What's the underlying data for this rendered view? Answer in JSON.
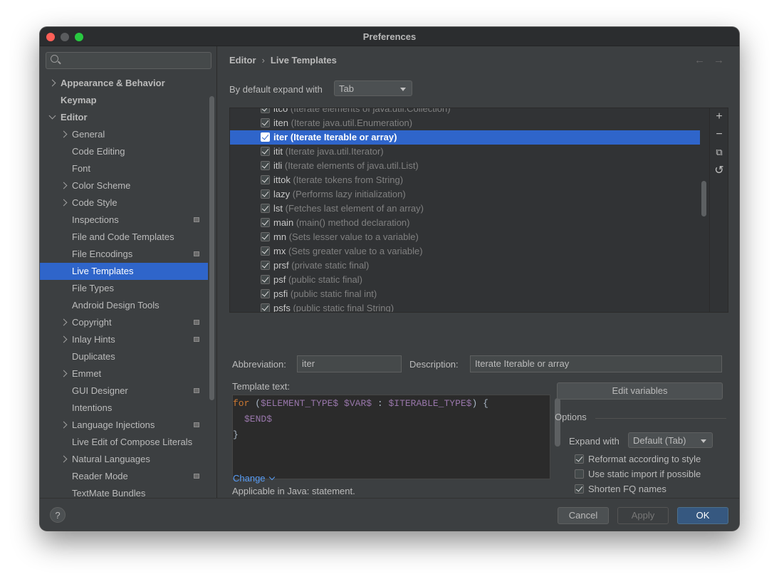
{
  "window": {
    "title": "Preferences"
  },
  "sidebar": {
    "search_placeholder": "",
    "items": [
      {
        "label": "Appearance & Behavior",
        "level": 0,
        "expander": "right",
        "bold": true,
        "selected": false,
        "project_icon": false
      },
      {
        "label": "Keymap",
        "level": 0,
        "expander": "",
        "bold": true,
        "selected": false,
        "project_icon": false
      },
      {
        "label": "Editor",
        "level": 0,
        "expander": "down",
        "bold": true,
        "selected": false,
        "project_icon": false
      },
      {
        "label": "General",
        "level": 1,
        "expander": "right",
        "bold": false,
        "selected": false,
        "project_icon": false
      },
      {
        "label": "Code Editing",
        "level": 1,
        "expander": "",
        "bold": false,
        "selected": false,
        "project_icon": false
      },
      {
        "label": "Font",
        "level": 1,
        "expander": "",
        "bold": false,
        "selected": false,
        "project_icon": false
      },
      {
        "label": "Color Scheme",
        "level": 1,
        "expander": "right",
        "bold": false,
        "selected": false,
        "project_icon": false
      },
      {
        "label": "Code Style",
        "level": 1,
        "expander": "right",
        "bold": false,
        "selected": false,
        "project_icon": false
      },
      {
        "label": "Inspections",
        "level": 1,
        "expander": "",
        "bold": false,
        "selected": false,
        "project_icon": true
      },
      {
        "label": "File and Code Templates",
        "level": 1,
        "expander": "",
        "bold": false,
        "selected": false,
        "project_icon": false
      },
      {
        "label": "File Encodings",
        "level": 1,
        "expander": "",
        "bold": false,
        "selected": false,
        "project_icon": true
      },
      {
        "label": "Live Templates",
        "level": 1,
        "expander": "",
        "bold": false,
        "selected": true,
        "project_icon": false
      },
      {
        "label": "File Types",
        "level": 1,
        "expander": "",
        "bold": false,
        "selected": false,
        "project_icon": false
      },
      {
        "label": "Android Design Tools",
        "level": 1,
        "expander": "",
        "bold": false,
        "selected": false,
        "project_icon": false
      },
      {
        "label": "Copyright",
        "level": 1,
        "expander": "right",
        "bold": false,
        "selected": false,
        "project_icon": true
      },
      {
        "label": "Inlay Hints",
        "level": 1,
        "expander": "right",
        "bold": false,
        "selected": false,
        "project_icon": true
      },
      {
        "label": "Duplicates",
        "level": 1,
        "expander": "",
        "bold": false,
        "selected": false,
        "project_icon": false
      },
      {
        "label": "Emmet",
        "level": 1,
        "expander": "right",
        "bold": false,
        "selected": false,
        "project_icon": false
      },
      {
        "label": "GUI Designer",
        "level": 1,
        "expander": "",
        "bold": false,
        "selected": false,
        "project_icon": true
      },
      {
        "label": "Intentions",
        "level": 1,
        "expander": "",
        "bold": false,
        "selected": false,
        "project_icon": false
      },
      {
        "label": "Language Injections",
        "level": 1,
        "expander": "right",
        "bold": false,
        "selected": false,
        "project_icon": true
      },
      {
        "label": "Live Edit of Compose Literals",
        "level": 1,
        "expander": "",
        "bold": false,
        "selected": false,
        "project_icon": false
      },
      {
        "label": "Natural Languages",
        "level": 1,
        "expander": "right",
        "bold": false,
        "selected": false,
        "project_icon": false
      },
      {
        "label": "Reader Mode",
        "level": 1,
        "expander": "",
        "bold": false,
        "selected": false,
        "project_icon": true
      },
      {
        "label": "TextMate Bundles",
        "level": 1,
        "expander": "",
        "bold": false,
        "selected": false,
        "project_icon": false
      }
    ]
  },
  "breadcrumb": {
    "parent": "Editor",
    "separator": "›",
    "current": "Live Templates",
    "back_arrow": "←",
    "forward_arrow": "→"
  },
  "expand": {
    "label": "By default expand with",
    "value": "Tab"
  },
  "templates": [
    {
      "abbr": "itco",
      "desc": "(Iterate elements of java.util.Collection)",
      "checked": true,
      "selected": false
    },
    {
      "abbr": "iten",
      "desc": "(Iterate java.util.Enumeration)",
      "checked": true,
      "selected": false
    },
    {
      "abbr": "iter",
      "desc": "(Iterate Iterable or array)",
      "checked": true,
      "selected": true
    },
    {
      "abbr": "itit",
      "desc": "(Iterate java.util.Iterator)",
      "checked": true,
      "selected": false
    },
    {
      "abbr": "itli",
      "desc": "(Iterate elements of java.util.List)",
      "checked": true,
      "selected": false
    },
    {
      "abbr": "ittok",
      "desc": "(Iterate tokens from String)",
      "checked": true,
      "selected": false
    },
    {
      "abbr": "lazy",
      "desc": "(Performs lazy initialization)",
      "checked": true,
      "selected": false
    },
    {
      "abbr": "lst",
      "desc": "(Fetches last element of an array)",
      "checked": true,
      "selected": false
    },
    {
      "abbr": "main",
      "desc": "(main() method declaration)",
      "checked": true,
      "selected": false
    },
    {
      "abbr": "mn",
      "desc": "(Sets lesser value to a variable)",
      "checked": true,
      "selected": false
    },
    {
      "abbr": "mx",
      "desc": "(Sets greater value to a variable)",
      "checked": true,
      "selected": false
    },
    {
      "abbr": "prsf",
      "desc": "(private static final)",
      "checked": true,
      "selected": false
    },
    {
      "abbr": "psf",
      "desc": "(public static final)",
      "checked": true,
      "selected": false
    },
    {
      "abbr": "psfi",
      "desc": "(public static final int)",
      "checked": true,
      "selected": false
    },
    {
      "abbr": "psfs",
      "desc": "(public static final String)",
      "checked": true,
      "selected": false
    }
  ],
  "list_toolbar": {
    "add": "+",
    "remove": "−",
    "copy": "⧉",
    "restore": "↺"
  },
  "abbreviation": {
    "label": "Abbreviation:",
    "value": "iter"
  },
  "description": {
    "label": "Description:",
    "value": "Iterate Iterable or array"
  },
  "template_text": {
    "label": "Template text:",
    "line1_kw": "for",
    "line1_open": " (",
    "line1_var1": "$ELEMENT_TYPE$",
    "line1_sp": " ",
    "line1_var2": "$VAR$",
    "line1_colon": " : ",
    "line1_var3": "$ITERABLE_TYPE$",
    "line1_close": ") {",
    "line2_var": "$END$",
    "line3": "}"
  },
  "edit_variables_label": "Edit variables",
  "options": {
    "title": "Options",
    "expand_with_label": "Expand with",
    "expand_with_value": "Default (Tab)",
    "reformat": {
      "label": "Reformat according to style",
      "checked": true
    },
    "static_import": {
      "label": "Use static import if possible",
      "checked": false
    },
    "shorten_fq": {
      "label": "Shorten FQ names",
      "checked": true
    }
  },
  "applicable": {
    "text": "Applicable in Java: statement.",
    "change_link": "Change"
  },
  "footer": {
    "help": "?",
    "cancel": "Cancel",
    "apply": "Apply",
    "ok": "OK"
  }
}
